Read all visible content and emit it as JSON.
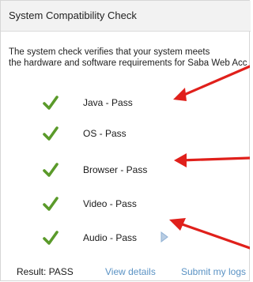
{
  "window": {
    "title": "System Compatibility Check"
  },
  "intro": {
    "line1": "The system check verifies that your system meets",
    "line2": "the hardware and software requirements for Saba Web Access."
  },
  "checks": [
    {
      "label": "Java - Pass",
      "status": "pass",
      "icon": "check-icon"
    },
    {
      "label": "OS - Pass",
      "status": "pass",
      "icon": "check-icon"
    },
    {
      "label": "Browser - Pass",
      "status": "pass",
      "icon": "check-icon"
    },
    {
      "label": "Video - Pass",
      "status": "pass",
      "icon": "check-icon"
    },
    {
      "label": "Audio - Pass",
      "status": "pass",
      "icon": "check-icon"
    }
  ],
  "footer": {
    "result": "Result: PASS",
    "view_details": "View details",
    "submit_logs": "Submit my logs"
  },
  "colors": {
    "check": "#5a9a2a",
    "link": "#5a92c4",
    "annotation_arrow": "#e0201b",
    "header_bg": "#f2f2f2"
  }
}
